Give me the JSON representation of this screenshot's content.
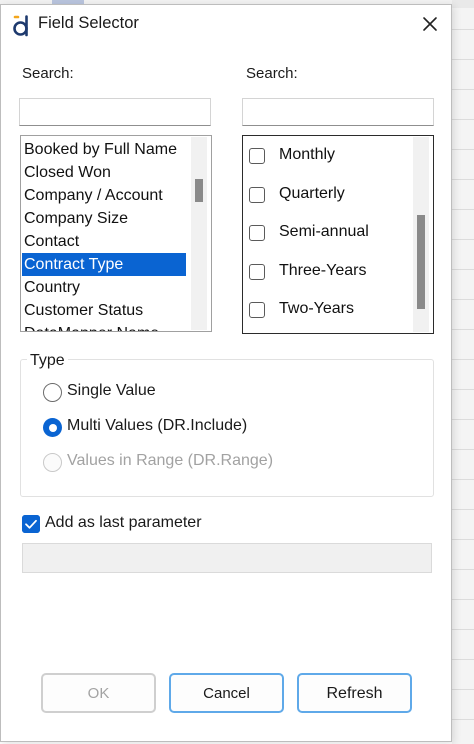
{
  "dialog": {
    "title": "Field Selector",
    "close_icon": "close-icon",
    "logo_icon": "app-logo-icon",
    "accent_color": "#0a64d2"
  },
  "fields_panel": {
    "search_label": "Search:",
    "search_value": "",
    "items": [
      "Booked by Full Name",
      "Closed Won",
      "Company / Account",
      "Company Size",
      "Contact",
      "Contract Type",
      "Country",
      "Customer Status",
      "DataMapper Name"
    ],
    "selected_item": "Contract Type"
  },
  "values_panel": {
    "search_label": "Search:",
    "search_value": "",
    "items": [
      {
        "label": "Monthly",
        "checked": false
      },
      {
        "label": "Quarterly",
        "checked": false
      },
      {
        "label": "Semi-annual",
        "checked": false
      },
      {
        "label": "Three-Years",
        "checked": false
      },
      {
        "label": "Two-Years",
        "checked": false
      }
    ]
  },
  "type_group": {
    "title": "Type",
    "options": [
      {
        "label": "Single Value",
        "checked": false,
        "enabled": true
      },
      {
        "label": "Multi Values (DR.Include)",
        "checked": true,
        "enabled": true
      },
      {
        "label": "Values in Range (DR.Range)",
        "checked": false,
        "enabled": false
      }
    ]
  },
  "add_last": {
    "label": "Add as last parameter",
    "checked": true
  },
  "parameter_field": {
    "value": ""
  },
  "buttons": {
    "ok": "OK",
    "cancel": "Cancel",
    "refresh": "Refresh"
  }
}
